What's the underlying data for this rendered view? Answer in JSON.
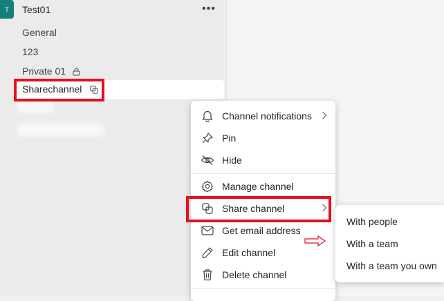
{
  "team": {
    "avatar_letter": "T",
    "name": "Test01",
    "more_icon": "more-horizontal-icon"
  },
  "channels": [
    {
      "label": "General"
    },
    {
      "label": "123"
    },
    {
      "label": "Private 01",
      "icon": "lock-icon"
    },
    {
      "label": "Sharechannel",
      "icon": "shared-channel-icon",
      "selected": true
    }
  ],
  "context_menu": {
    "items": [
      {
        "label": "Channel notifications",
        "icon": "bell-icon",
        "has_submenu": true
      },
      {
        "label": "Pin",
        "icon": "pin-icon"
      },
      {
        "label": "Hide",
        "icon": "eye-off-icon"
      },
      {
        "label": "Manage channel",
        "icon": "gear-icon"
      },
      {
        "label": "Share channel",
        "icon": "share-channel-icon",
        "has_submenu": true,
        "highlighted": true
      },
      {
        "label": "Get email address",
        "icon": "mail-icon"
      },
      {
        "label": "Edit channel",
        "icon": "pencil-icon"
      },
      {
        "label": "Delete channel",
        "icon": "trash-icon"
      }
    ]
  },
  "share_submenu": {
    "items": [
      {
        "label": "With people"
      },
      {
        "label": "With a team"
      },
      {
        "label": "With a team you own"
      }
    ]
  },
  "colors": {
    "annotation_red": "#e3101e",
    "team_accent": "#13807c"
  }
}
